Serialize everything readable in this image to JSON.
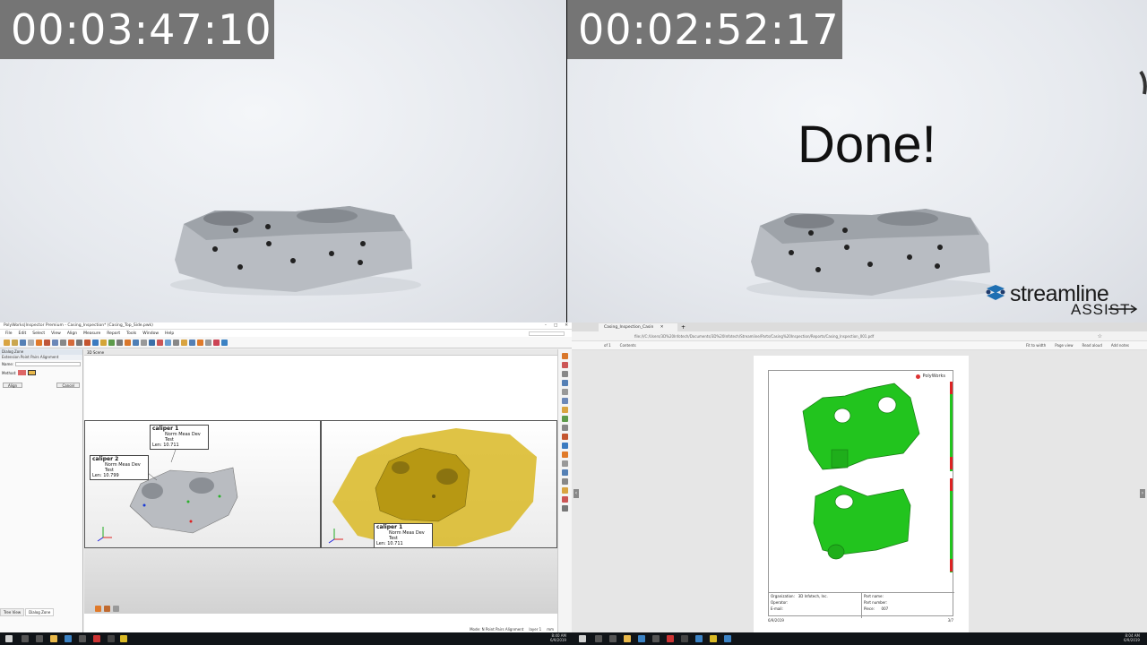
{
  "left_video": {
    "timer": "00:03:47:10"
  },
  "right_video": {
    "timer": "00:02:52:17",
    "overlay_text": "Done!",
    "brand": {
      "name": "streamline",
      "sub": "ASSIST"
    }
  },
  "polyworks": {
    "title": "PolyWorks|Inspector Premium - Casing_Inspection* (Casing_Top_Side.pwk)",
    "menu": [
      "File",
      "Edit",
      "Select",
      "View",
      "Align",
      "Measure",
      "Report",
      "Tools",
      "Window",
      "Help"
    ],
    "panel_header": "Dialog Zone",
    "panel_subheader": "Extension Point Pairs Alignment",
    "name_label": "Name:",
    "method_label": "Method:",
    "align_button": "Align",
    "cancel_button": "Cancel",
    "tabs": [
      "Tree View",
      "Dialog Zone"
    ],
    "scene_title": "3D Scene",
    "callouts": [
      {
        "title": "caliper 1",
        "sub": "Norm Meas Dev Test",
        "value": "Len: 10.711"
      },
      {
        "title": "caliper 2",
        "sub": "Norm Meas Dev Test",
        "value": "Len: 10.799"
      },
      {
        "title": "caliper 1",
        "sub": "Norm Meas Dev Test",
        "value": "Len: 10.711"
      }
    ],
    "status": {
      "mode": "Mode: N Point Pairs Alignment",
      "layer": "layer 1",
      "unit": "mm"
    }
  },
  "browser": {
    "tab_title": "Casing_Inspection_Casin",
    "url": "file:///C:/Users/3D%20Infotech/Documents/3D%20Infotech/Streamline/Parts/Casing%20Inspection/Reports/Casing_Inspection_001.pdf",
    "page_of": "of 1",
    "contents": "Contents",
    "toolbar_right": [
      "Fit to width",
      "Page view",
      "Read aloud",
      "Add notes"
    ],
    "report": {
      "logo": "PolyWorks",
      "fields_left": [
        {
          "label": "Organization:",
          "value": "3D Infotech, Inc."
        },
        {
          "label": "Operator:",
          "value": ""
        },
        {
          "label": "E-mail:",
          "value": ""
        }
      ],
      "fields_right": [
        {
          "label": "Part name:",
          "value": ""
        },
        {
          "label": "Part number:",
          "value": ""
        },
        {
          "label": "Piece:",
          "value": "007"
        }
      ],
      "date": "6/9/2019",
      "page": "3/7"
    }
  },
  "taskbar": {
    "clock_left": {
      "time": "8:40 AM",
      "date": "6/9/2019"
    },
    "clock_right": {
      "time": "8:04 AM",
      "date": "6/9/2019"
    }
  },
  "colors": {
    "timer_bg": "#757575",
    "inspection_green": "#22c41e",
    "scan_yellow": "#d4b21a"
  }
}
